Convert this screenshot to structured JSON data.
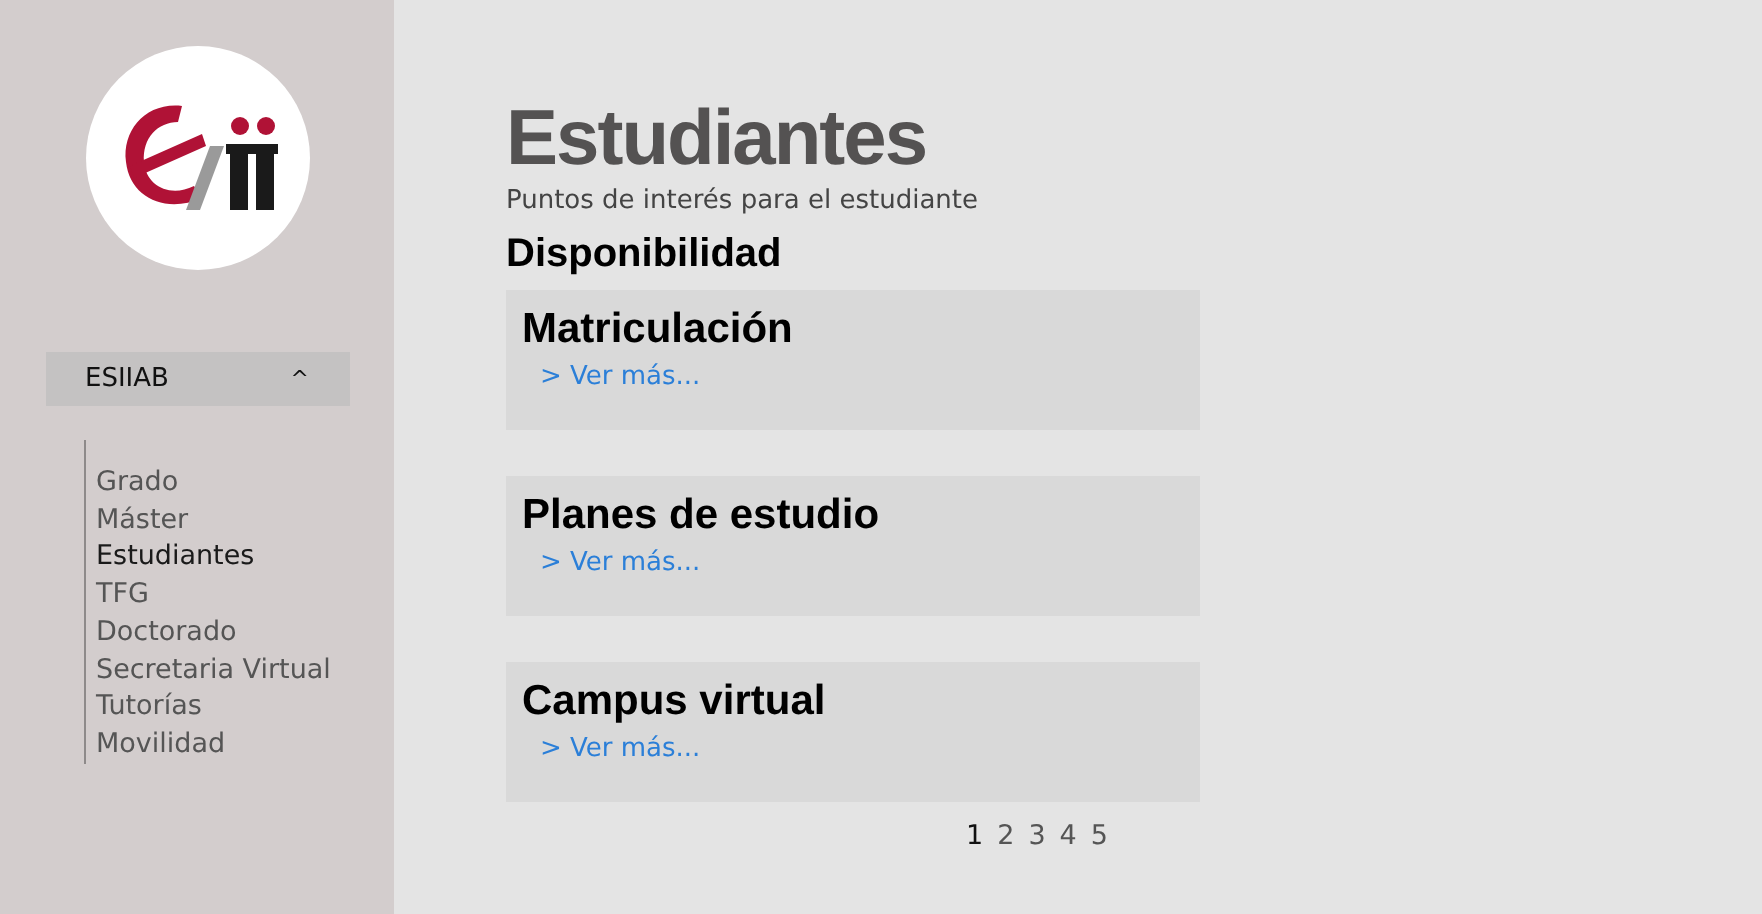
{
  "sidebar": {
    "dropdown": {
      "label": "ESIIAB",
      "caret": "^",
      "expanded": true
    },
    "items": [
      {
        "label": "Grado",
        "selected": false
      },
      {
        "label": "Máster",
        "selected": false
      },
      {
        "label": "Estudiantes",
        "selected": true
      },
      {
        "label": "TFG",
        "selected": false
      },
      {
        "label": "Doctorado",
        "selected": false
      },
      {
        "label": "Secretaria Virtual",
        "selected": false
      },
      {
        "label": "Tutorías",
        "selected": false
      },
      {
        "label": "Movilidad",
        "selected": false
      }
    ]
  },
  "page": {
    "title": "Estudiantes",
    "subtitle": "Puntos de interés para el estudiante",
    "section": "Disponibilidad"
  },
  "cards": [
    {
      "title": "Matriculación",
      "link": "> Ver más..."
    },
    {
      "title": "Planes de estudio",
      "link": "> Ver más..."
    },
    {
      "title": "Campus virtual",
      "link": "> Ver más..."
    }
  ],
  "pagination": [
    {
      "label": "1",
      "selected": true
    },
    {
      "label": "2",
      "selected": false
    },
    {
      "label": "3",
      "selected": false
    },
    {
      "label": "4",
      "selected": false
    },
    {
      "label": "5",
      "selected": false
    }
  ]
}
